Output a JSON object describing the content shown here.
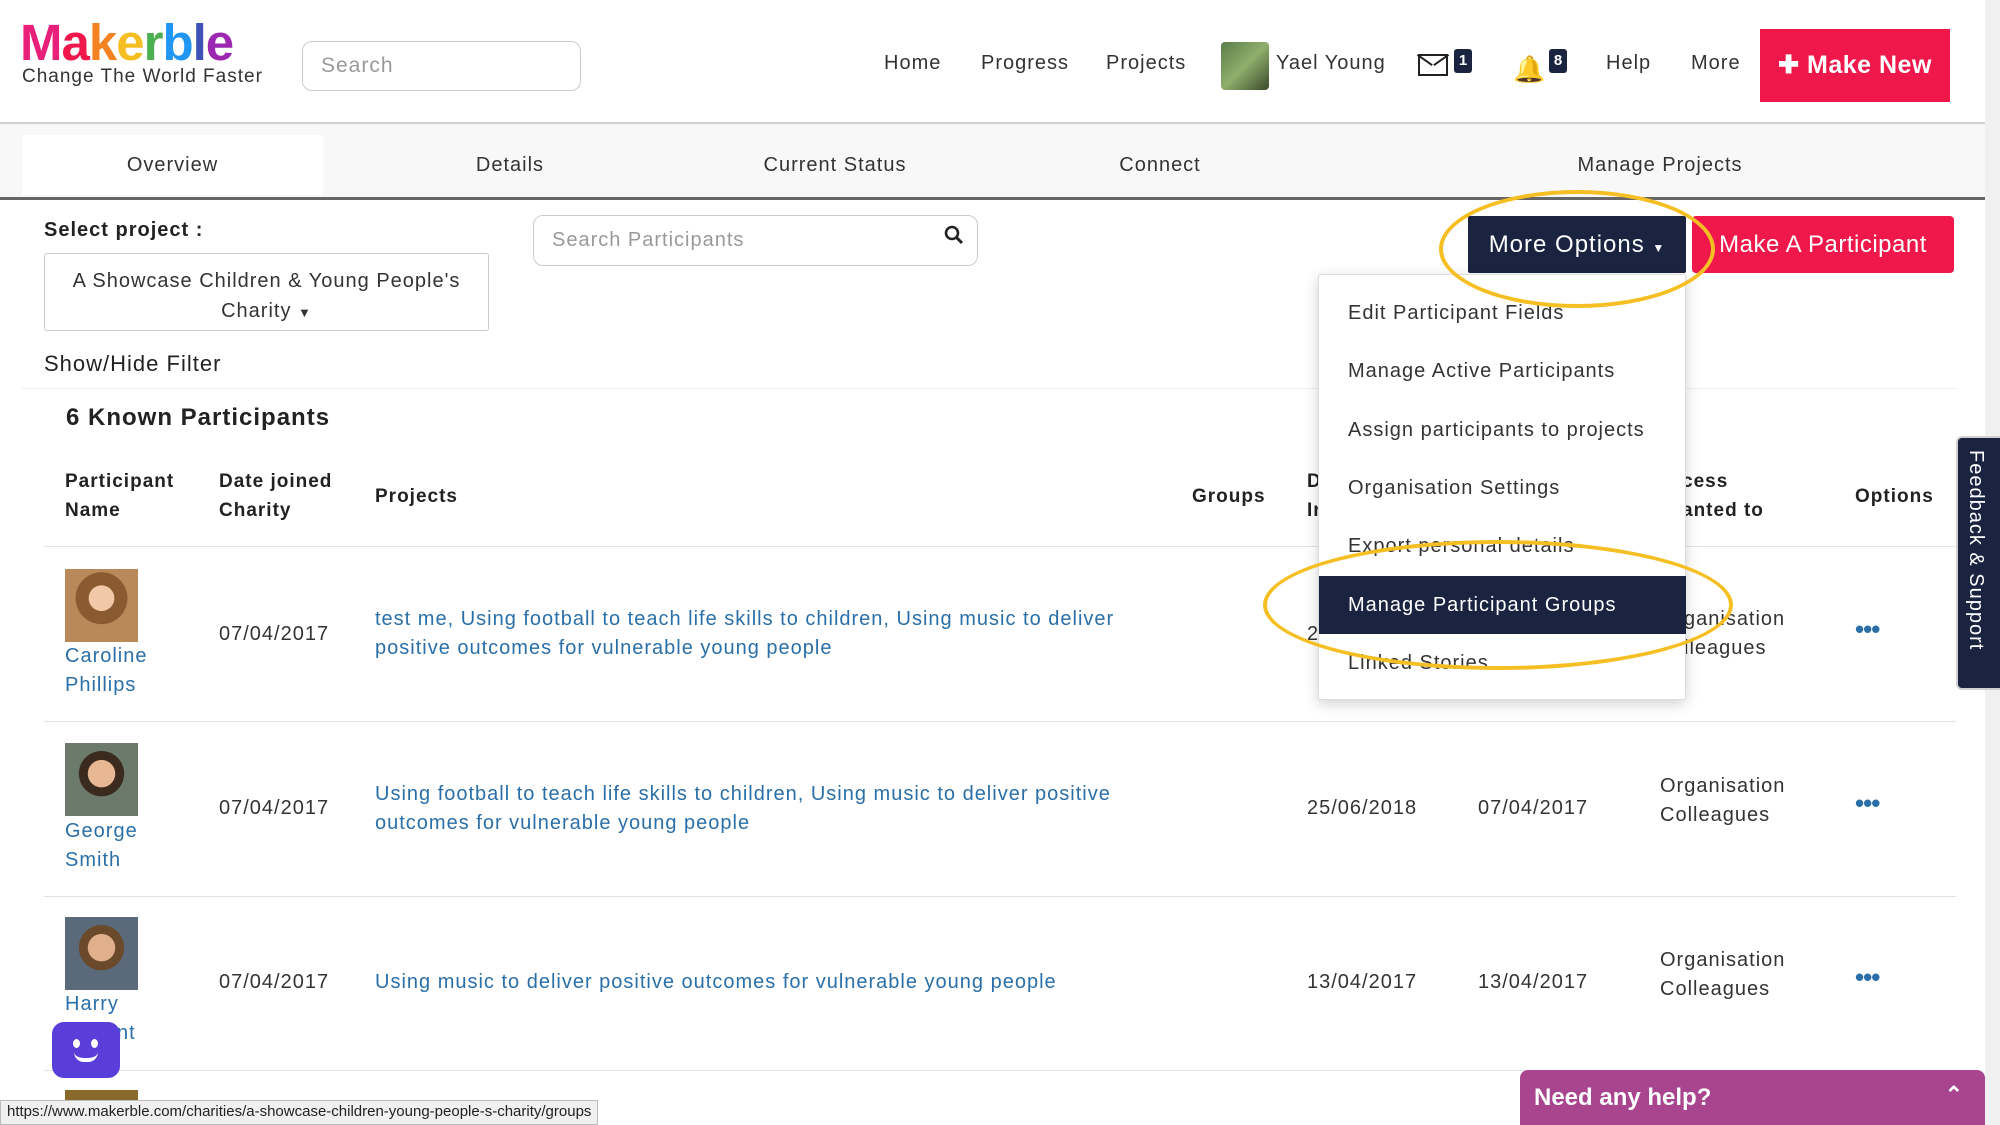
{
  "header": {
    "logo": "Makerble",
    "tagline": "Change The World Faster",
    "search_placeholder": "Search",
    "nav": [
      "Home",
      "Progress",
      "Projects"
    ],
    "user_name": "Yael Young",
    "mail_count": "1",
    "notif_count": "8",
    "help": "Help",
    "more": "More",
    "make_new": "Make New"
  },
  "tabs": [
    "Overview",
    "Details",
    "Current Status",
    "Connect",
    "Manage Projects"
  ],
  "controls": {
    "select_label": "Select project :",
    "project_line1": "A Showcase Children & Young People's",
    "project_line2": "Charity",
    "search_participants": "Search Participants",
    "more_options": "More Options",
    "make_participant": "Make A Participant",
    "show_hide_filter": "Show/Hide Filter"
  },
  "dropdown": [
    "Edit Participant Fields",
    "Manage Active Participants",
    "Assign participants to projects",
    "Organisation Settings",
    "Export personal details",
    "Manage Participant Groups",
    "Linked Stories"
  ],
  "table": {
    "heading": "6 Known Participants",
    "headers": {
      "name1": "Participant",
      "name2": "Name",
      "date1": "Date joined",
      "date2": "Charity",
      "projects": "Projects",
      "groups": "Groups",
      "d1": "D",
      "d2": "Ir",
      "access1": "cess",
      "access2": "anted to",
      "options": "Options"
    },
    "rows": [
      {
        "first": "Caroline",
        "last": "Phillips",
        "joined": "07/04/2017",
        "projects1": "test me, Using football to teach life skills to children, Using music to deliver",
        "projects2": "positive outcomes for vulnerable young people",
        "col5": "2",
        "col6": "",
        "access1": "ganisation",
        "access2": "lleagues"
      },
      {
        "first": "George",
        "last": "Smith",
        "joined": "07/04/2017",
        "projects1": "Using football to teach life skills to children, Using music to deliver positive",
        "projects2": "outcomes for vulnerable young people",
        "col5": "25/06/2018",
        "col6": "07/04/2017",
        "access1": "Organisation",
        "access2": "Colleagues"
      },
      {
        "first": "Harry",
        "last": "nt",
        "joined": "07/04/2017",
        "projects1": "Using music to deliver positive outcomes for vulnerable young people",
        "projects2": "",
        "col5": "13/04/2017",
        "col6": "13/04/2017",
        "access1": "Organisation",
        "access2": "Colleagues"
      }
    ]
  },
  "feedback": "Feedback & Support",
  "help_bar": "Need any help?",
  "status_url": "https://www.makerble.com/charities/a-showcase-children-young-people-s-charity/groups",
  "colors": {
    "brand_red": "#f0184a",
    "navy": "#1a2340",
    "link": "#2a6fa8",
    "highlight": "#f5bf24",
    "help_purple": "#a8458e"
  }
}
